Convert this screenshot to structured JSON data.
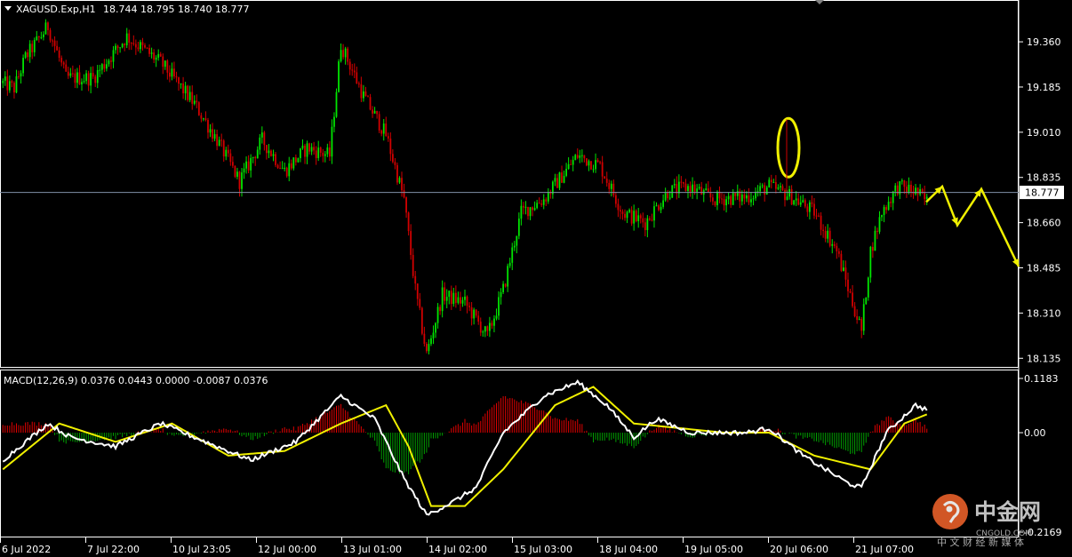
{
  "colors": {
    "background": "#000000",
    "bull": "#00e400",
    "bear": "#d10000",
    "frame": "#ffffff",
    "price_line": "#8090a8",
    "annotation": "#f0f000",
    "macd_line": "#ffffff",
    "signal_line": "#f0f000",
    "hist_pos": "#e00000",
    "hist_neg": "#00a000",
    "watermark": "#d6d6d6"
  },
  "header": {
    "symbol": "XAGUSD.Exp,H1",
    "ohlc": "18.744 18.795 18.740 18.777"
  },
  "macd_header": "MACD(12,26,9) 0.0376 0.0443 0.0000 -0.0087 0.0376",
  "watermark": {
    "cn_name": "中金网",
    "domain": "CNGOLD.COM",
    "subtitle": "中 文 财 经 新 媒 体"
  },
  "chart_data": [
    {
      "type": "candlestick",
      "symbol": "XAGUSD",
      "timeframe": "H1",
      "current_price": 18.777,
      "current_price_label": "18.777",
      "y_ticks": [
        "19.360",
        "19.185",
        "19.010",
        "18.835",
        "18.660",
        "18.485",
        "18.310",
        "18.135"
      ],
      "ylim": [
        18.105,
        19.515
      ],
      "x_ticks": [
        "6 Jul 2022",
        "7 Jul 22:00",
        "10 Jul 23:05",
        "12 Jul 00:00",
        "13 Jul 01:00",
        "14 Jul 02:00",
        "15 Jul 03:00",
        "18 Jul 04:00",
        "19 Jul 05:00",
        "20 Jul 06:00",
        "21 Jul 07:00"
      ],
      "close_path_keypoints": [
        [
          0,
          19.2
        ],
        [
          5,
          19.18
        ],
        [
          10,
          19.3
        ],
        [
          20,
          19.42
        ],
        [
          28,
          19.22
        ],
        [
          40,
          19.22
        ],
        [
          55,
          19.38
        ],
        [
          70,
          19.28
        ],
        [
          85,
          19.12
        ],
        [
          95,
          18.98
        ],
        [
          105,
          18.82
        ],
        [
          115,
          18.98
        ],
        [
          125,
          18.86
        ],
        [
          135,
          18.95
        ],
        [
          145,
          18.92
        ],
        [
          150,
          19.35
        ],
        [
          160,
          19.15
        ],
        [
          170,
          19.0
        ],
        [
          178,
          18.75
        ],
        [
          183,
          18.4
        ],
        [
          188,
          18.15
        ],
        [
          195,
          18.38
        ],
        [
          205,
          18.35
        ],
        [
          215,
          18.22
        ],
        [
          222,
          18.4
        ],
        [
          230,
          18.7
        ],
        [
          240,
          18.75
        ],
        [
          255,
          18.92
        ],
        [
          265,
          18.88
        ],
        [
          275,
          18.7
        ],
        [
          285,
          18.66
        ],
        [
          295,
          18.78
        ],
        [
          305,
          18.8
        ],
        [
          315,
          18.75
        ],
        [
          330,
          18.76
        ],
        [
          340,
          18.8
        ],
        [
          350,
          18.76
        ],
        [
          360,
          18.7
        ],
        [
          370,
          18.55
        ],
        [
          377,
          18.35
        ],
        [
          381,
          18.24
        ],
        [
          385,
          18.55
        ],
        [
          390,
          18.7
        ],
        [
          397,
          18.8
        ],
        [
          405,
          18.78
        ],
        [
          410,
          18.74
        ]
      ],
      "annotations": [
        {
          "type": "ellipse",
          "note": "long upper wick near 20 Jul 06:00"
        },
        {
          "type": "projected_path",
          "prices": [
            18.74,
            18.8,
            18.65,
            18.79,
            18.49
          ]
        }
      ]
    },
    {
      "type": "line",
      "name": "MACD(12,26,9)",
      "y_ticks": [
        "0.1183",
        "0.00",
        "-0.2169"
      ],
      "ylim": [
        -0.2169,
        0.1183
      ],
      "series": [
        {
          "name": "MACD",
          "keypoints": [
            [
              0,
              -0.06
            ],
            [
              20,
              0.02
            ],
            [
              30,
              -0.01
            ],
            [
              50,
              -0.03
            ],
            [
              70,
              0.02
            ],
            [
              90,
              -0.02
            ],
            [
              110,
              -0.06
            ],
            [
              130,
              -0.02
            ],
            [
              150,
              0.08
            ],
            [
              165,
              0.03
            ],
            [
              178,
              -0.1
            ],
            [
              188,
              -0.18
            ],
            [
              200,
              -0.15
            ],
            [
              210,
              -0.12
            ],
            [
              222,
              0.0
            ],
            [
              240,
              0.08
            ],
            [
              255,
              0.11
            ],
            [
              268,
              0.06
            ],
            [
              280,
              -0.01
            ],
            [
              290,
              0.03
            ],
            [
              305,
              0.0
            ],
            [
              330,
              0.0
            ],
            [
              340,
              0.01
            ],
            [
              355,
              -0.05
            ],
            [
              375,
              -0.11
            ],
            [
              381,
              -0.12
            ],
            [
              392,
              0.0
            ],
            [
              405,
              0.06
            ],
            [
              410,
              0.05
            ]
          ]
        },
        {
          "name": "Signal",
          "keypoints": [
            [
              0,
              -0.08
            ],
            [
              25,
              0.02
            ],
            [
              50,
              -0.02
            ],
            [
              75,
              0.02
            ],
            [
              100,
              -0.05
            ],
            [
              125,
              -0.04
            ],
            [
              150,
              0.02
            ],
            [
              170,
              0.06
            ],
            [
              180,
              -0.03
            ],
            [
              190,
              -0.16
            ],
            [
              205,
              -0.16
            ],
            [
              222,
              -0.08
            ],
            [
              245,
              0.06
            ],
            [
              262,
              0.1
            ],
            [
              280,
              0.02
            ],
            [
              300,
              0.01
            ],
            [
              320,
              0.0
            ],
            [
              340,
              0.0
            ],
            [
              360,
              -0.05
            ],
            [
              385,
              -0.08
            ],
            [
              400,
              0.02
            ],
            [
              410,
              0.04
            ]
          ]
        }
      ]
    }
  ]
}
